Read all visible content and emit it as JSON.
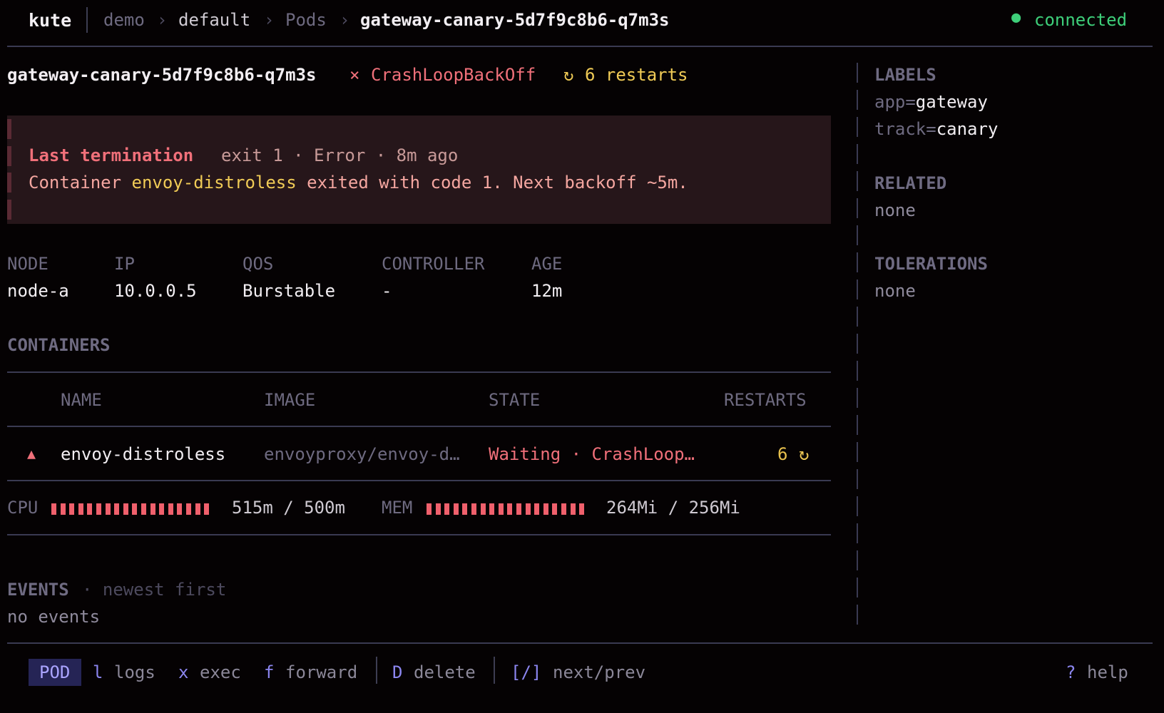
{
  "header": {
    "brand": "kute",
    "breadcrumb": [
      "demo",
      "default",
      "Pods",
      "gateway-canary-5d7f9c8b6-q7m3s"
    ],
    "separator": "›",
    "status": "connected"
  },
  "pod": {
    "name": "gateway-canary-5d7f9c8b6-q7m3s",
    "status_icon": "×",
    "status": "CrashLoopBackOff",
    "restart_icon": "↻",
    "restarts_label": "6 restarts"
  },
  "termination": {
    "title": "Last termination",
    "meta": "exit 1 · Error · 8m ago",
    "msg_prefix": "Container ",
    "container": "envoy-distroless",
    "msg_suffix": " exited with code 1. Next backoff ~5m."
  },
  "info": {
    "headers": [
      "NODE",
      "IP",
      "QOS",
      "CONTROLLER",
      "AGE"
    ],
    "values": [
      "node-a",
      "10.0.0.5",
      "Burstable",
      "-",
      "12m"
    ]
  },
  "containers": {
    "title": "CONTAINERS",
    "headers": [
      "NAME",
      "IMAGE",
      "STATE",
      "RESTARTS"
    ],
    "row": {
      "warn_icon": "▲",
      "name": "envoy-distroless",
      "image": "envoyproxy/envoy-d…",
      "state": "Waiting · CrashLoop…",
      "restarts": "6",
      "restart_icon": "↻"
    },
    "cpu": {
      "label": "CPU",
      "value": "515m / 500m",
      "fill": 1.0
    },
    "mem": {
      "label": "MEM",
      "value": "264Mi / 256Mi",
      "fill": 1.0
    }
  },
  "events": {
    "title": "EVENTS",
    "subtitle": "· newest first",
    "empty": "no events"
  },
  "sidebar": {
    "labels_title": "LABELS",
    "labels": [
      {
        "key": "app=",
        "value": "gateway"
      },
      {
        "key": "track=",
        "value": "canary"
      }
    ],
    "related_title": "RELATED",
    "related": "none",
    "tolerations_title": "TOLERATIONS",
    "tolerations": "none"
  },
  "footer": {
    "mode": "POD",
    "keys": [
      {
        "key": "l",
        "label": "logs"
      },
      {
        "key": "x",
        "label": "exec"
      },
      {
        "key": "f",
        "label": "forward"
      },
      {
        "key": "D",
        "label": "delete"
      },
      {
        "key": "[/]",
        "label": "next/prev"
      }
    ],
    "help_key": "?",
    "help_label": "help"
  },
  "colors": {
    "background": "#050203",
    "error": "#f0707a",
    "warning": "#f0cb56",
    "ok": "#3ecf7a",
    "accent": "#8c86f0"
  }
}
